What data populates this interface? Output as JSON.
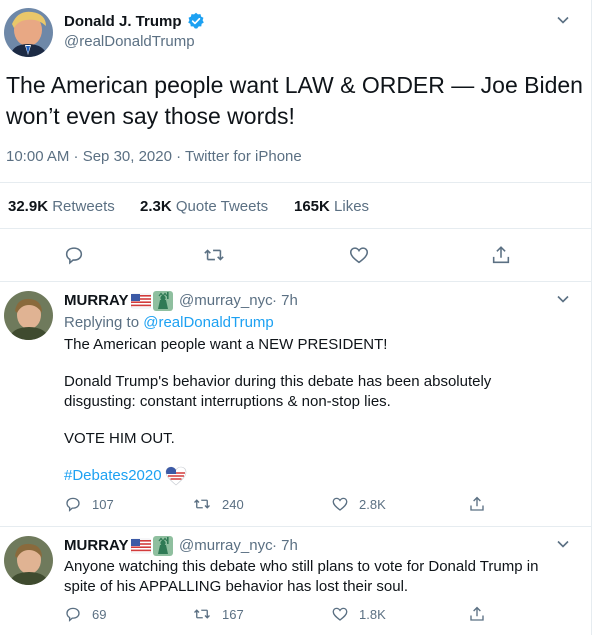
{
  "main_tweet": {
    "display_name": "Donald J. Trump",
    "handle": "@realDonaldTrump",
    "text_line1": "The American people want LAW & ORDER — Joe Biden",
    "text_line2": "won’t even say those words!",
    "meta": "10:00 AM · Sep 30, 2020 · Twitter for iPhone",
    "retweets_count": "32.9K",
    "retweets_label": "Retweets",
    "quotes_count": "2.3K",
    "quotes_label": "Quote Tweets",
    "likes_count": "165K",
    "likes_label": "Likes"
  },
  "replies": [
    {
      "display_name": "MURRAY",
      "handle": "@murray_nyc",
      "time": "· 7h",
      "replying_prefix": "Replying to",
      "replying_to": "@realDonaldTrump",
      "line1": "The American people want a NEW PRESIDENT!",
      "line2": "Donald Trump's behavior during this debate has been absolutely",
      "line3": "disgusting: constant interruptions & non-stop lies.",
      "line4": "VOTE HIM OUT.",
      "hashtag": "#Debates2020",
      "reply_count": "107",
      "retweet_count": "240",
      "like_count": "2.8K"
    },
    {
      "display_name": "MURRAY",
      "handle": "@murray_nyc",
      "time": "· 7h",
      "line1": "Anyone watching this debate who still plans to vote for Donald Trump in",
      "line2": "spite of his APPALLING behavior has lost their soul.",
      "reply_count": "69",
      "retweet_count": "167",
      "like_count": "1.8K"
    }
  ],
  "colors": {
    "accent": "#1da1f2",
    "secondary_text": "#5b7083",
    "divider": "#e6ecf0"
  },
  "icons": [
    "chevron-down-icon",
    "verified-badge-icon",
    "reply-icon",
    "retweet-icon",
    "like-icon",
    "share-icon",
    "us-flag-emoji",
    "statue-of-liberty-emoji",
    "flag-heart-emoji"
  ]
}
